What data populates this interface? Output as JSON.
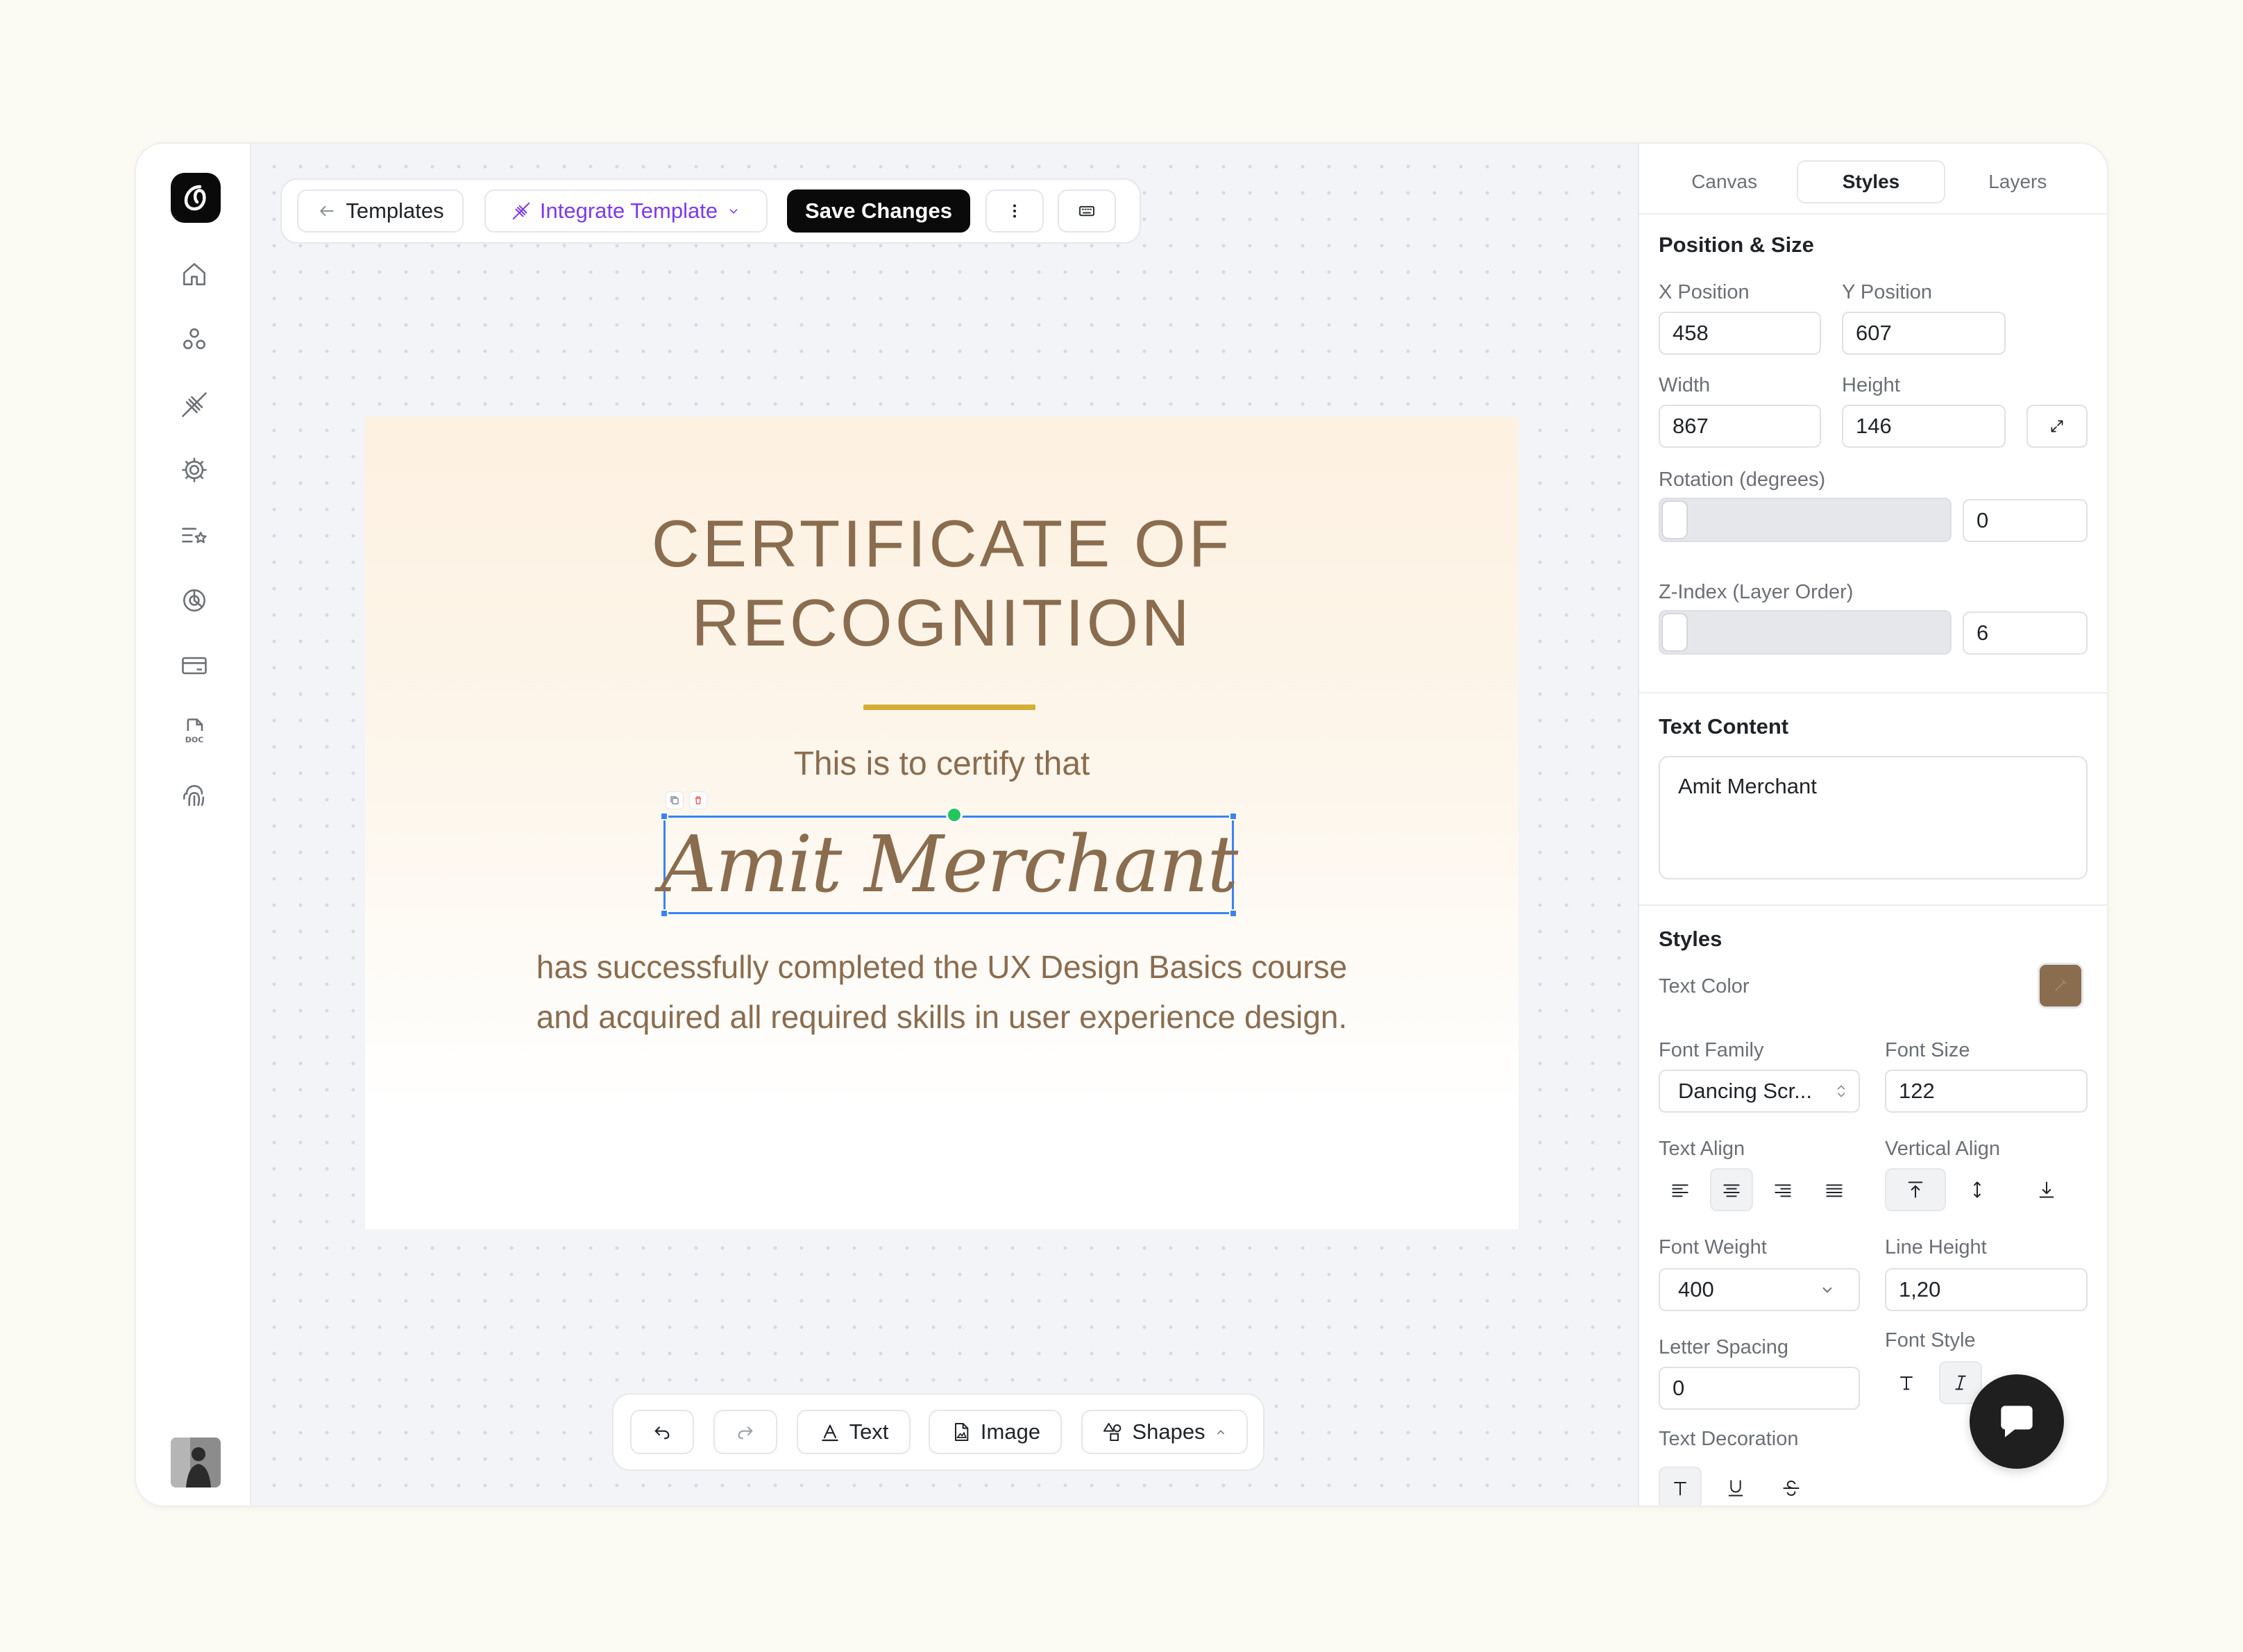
{
  "toolbar": {
    "templates_label": "Templates",
    "integrate_label": "Integrate Template",
    "save_label": "Save Changes"
  },
  "certificate": {
    "title_line1": "CERTIFICATE OF",
    "title_line2": "RECOGNITION",
    "certify_text": "This is to certify that",
    "recipient_name": "Amit Merchant",
    "body_line1": "has successfully completed the UX Design Basics course",
    "body_line2": "and acquired all required skills in user experience design.",
    "text_color": "#8a6c4e",
    "divider_color": "#d4af37"
  },
  "bottom_bar": {
    "text_label": "Text",
    "image_label": "Image",
    "shapes_label": "Shapes"
  },
  "panel": {
    "tabs": [
      {
        "label": "Canvas"
      },
      {
        "label": "Styles"
      },
      {
        "label": "Layers"
      }
    ],
    "position_size": {
      "title": "Position & Size",
      "x_label": "X Position",
      "x_value": "458",
      "y_label": "Y Position",
      "y_value": "607",
      "width_label": "Width",
      "width_value": "867",
      "height_label": "Height",
      "height_value": "146",
      "rotation_label": "Rotation (degrees)",
      "rotation_value": "0",
      "zindex_label": "Z-Index (Layer Order)",
      "zindex_value": "6"
    },
    "text_content": {
      "title": "Text Content",
      "value": "Amit Merchant"
    },
    "styles": {
      "title": "Styles",
      "text_color_label": "Text Color",
      "text_color_value": "#8a6c4e",
      "font_family_label": "Font Family",
      "font_family_value": "Dancing Scr...",
      "font_size_label": "Font Size",
      "font_size_value": "122",
      "text_align_label": "Text Align",
      "vertical_align_label": "Vertical Align",
      "font_weight_label": "Font Weight",
      "font_weight_value": "400",
      "line_height_label": "Line Height",
      "line_height_value": "1,20",
      "letter_spacing_label": "Letter Spacing",
      "letter_spacing_value": "0",
      "font_style_label": "Font Style",
      "text_decoration_label": "Text Decoration"
    }
  }
}
